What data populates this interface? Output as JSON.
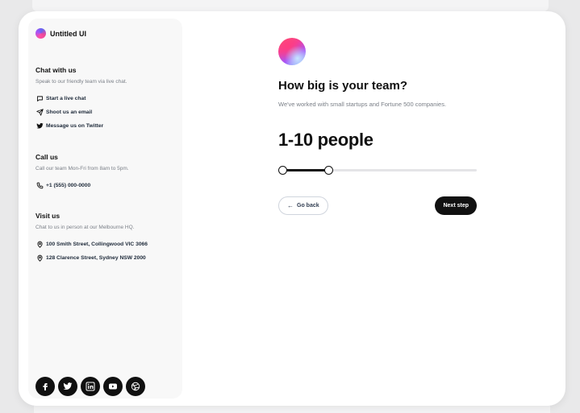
{
  "brand": {
    "name": "Untitled UI"
  },
  "sidebar": {
    "chat": {
      "title": "Chat with us",
      "description": "Speak to our friendly team via live chat.",
      "items": [
        {
          "label": "Start a live chat",
          "icon": "chat-bubble-icon"
        },
        {
          "label": "Shoot us an email",
          "icon": "send-icon"
        },
        {
          "label": "Message us on Twitter",
          "icon": "twitter-icon"
        }
      ]
    },
    "call": {
      "title": "Call us",
      "description": "Call our team Mon-Fri from 8am to 5pm.",
      "items": [
        {
          "label": "+1 (555) 000-0000",
          "icon": "phone-icon"
        }
      ]
    },
    "visit": {
      "title": "Visit us",
      "description": "Chat to us in person at our Melbourne HQ.",
      "items": [
        {
          "label": "100 Smith Street, Collingwood VIC 3066",
          "icon": "map-pin-icon"
        },
        {
          "label": "128 Clarence Street, Sydney NSW 2000",
          "icon": "map-pin-icon"
        }
      ]
    },
    "socials": [
      "facebook-icon",
      "twitter-icon",
      "linkedin-icon",
      "youtube-icon",
      "dribbble-icon"
    ]
  },
  "main": {
    "question": "How big is your team?",
    "subtitle": "We've worked with small startups and Fortune 500 companies.",
    "value": "1-10 people",
    "slider": {
      "low": 0.0,
      "high": 0.23
    },
    "back_label": "Go back",
    "next_label": "Next step"
  },
  "colors": {
    "primary": "#111111",
    "accent_gradient": [
      "#ff5a5a",
      "#f43f9a",
      "#a855f7",
      "#7dd3fc"
    ]
  }
}
